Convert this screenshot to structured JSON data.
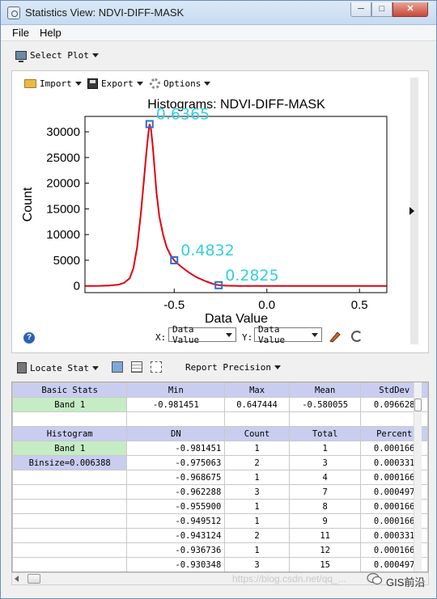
{
  "window": {
    "title": "Statistics View: NDVI-DIFF-MASK",
    "min_glyph": "─",
    "max_glyph": "□",
    "close_glyph": "✕"
  },
  "menu": {
    "file": "File",
    "help": "Help"
  },
  "toolbar": {
    "select_plot": "Select Plot"
  },
  "plot_toolbar": {
    "import": "Import",
    "export": "Export",
    "options": "Options"
  },
  "chart_data": {
    "type": "line",
    "title": "Histograms: NDVI-DIFF-MASK",
    "xlabel": "Data Value",
    "ylabel": "Count",
    "xlim": [
      -0.981451,
      0.647444
    ],
    "ylim": [
      -1300,
      33000
    ],
    "x_ticks": [
      -0.5,
      0.0,
      0.5
    ],
    "x_tick_labels": [
      "-0.5",
      "0.0",
      "0.5"
    ],
    "y_ticks": [
      0,
      5000,
      10000,
      15000,
      20000,
      25000,
      30000
    ],
    "y_tick_labels": [
      "0",
      "5000",
      "10000",
      "15000",
      "20000",
      "25000",
      "30000"
    ],
    "line_color": "#e3000f",
    "series": [
      {
        "x": [
          -0.98,
          -0.95,
          -0.9,
          -0.85,
          -0.8,
          -0.77,
          -0.74,
          -0.72,
          -0.7,
          -0.68,
          -0.665,
          -0.65,
          -0.64,
          -0.633,
          -0.625,
          -0.615,
          -0.605,
          -0.595,
          -0.58,
          -0.56,
          -0.54,
          -0.52,
          -0.5,
          -0.48,
          -0.45,
          -0.42,
          -0.38,
          -0.33,
          -0.29,
          -0.26,
          -0.22,
          -0.15,
          -0.05,
          0.1,
          0.3,
          0.5,
          0.645
        ],
        "y": [
          0,
          0,
          20,
          80,
          250,
          600,
          1500,
          3500,
          7500,
          14000,
          20000,
          26000,
          29500,
          31500,
          30500,
          27000,
          22500,
          18000,
          13500,
          10000,
          7500,
          6000,
          5000,
          4300,
          3400,
          2600,
          1700,
          900,
          400,
          150,
          50,
          10,
          0,
          0,
          0,
          0,
          0
        ]
      }
    ],
    "annotations": [
      {
        "text": "0.6365",
        "x": -0.633,
        "y": 31500
      },
      {
        "text": "0.4832",
        "x": -0.5,
        "y": 5000
      },
      {
        "text": "0.2825",
        "x": -0.26,
        "y": 150
      }
    ]
  },
  "axis_selectors": {
    "x_label": "X:",
    "x_value": "Data Value",
    "y_label": "Y:",
    "y_value": "Data Value"
  },
  "stat_toolbar": {
    "locate_stat": "Locate Stat",
    "report_precision": "Report Precision"
  },
  "basic_stats": {
    "headers": [
      "Basic Stats",
      "Min",
      "Max",
      "Mean",
      "StdDev"
    ],
    "rows": [
      [
        "Band 1",
        "-0.981451",
        "0.647444",
        "-0.580055",
        "0.096628"
      ]
    ]
  },
  "histogram": {
    "headers": [
      "Histogram",
      "DN",
      "Count",
      "Total",
      "Percent"
    ],
    "band": "Band 1",
    "binsize": "Binsize=0.006388",
    "rows": [
      [
        "-0.981451",
        "1",
        "1",
        "0.000166"
      ],
      [
        "-0.975063",
        "2",
        "3",
        "0.000331"
      ],
      [
        "-0.968675",
        "1",
        "4",
        "0.000166"
      ],
      [
        "-0.962288",
        "3",
        "7",
        "0.000497"
      ],
      [
        "-0.955900",
        "1",
        "8",
        "0.000166"
      ],
      [
        "-0.949512",
        "1",
        "9",
        "0.000166"
      ],
      [
        "-0.943124",
        "2",
        "11",
        "0.000331"
      ],
      [
        "-0.936736",
        "1",
        "12",
        "0.000166"
      ],
      [
        "-0.930348",
        "3",
        "15",
        "0.000497"
      ]
    ]
  },
  "footer": {
    "watermark": "https://blog.csdn.net/qq_...",
    "brand": "GIS前沿"
  }
}
